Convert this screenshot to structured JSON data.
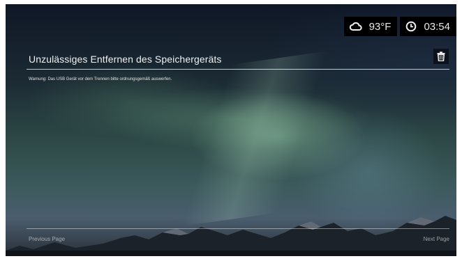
{
  "status": {
    "weather_icon": "cloud-icon",
    "temperature": "93°F",
    "clock_icon": "clock-icon",
    "time": "03:54"
  },
  "notification": {
    "title": "Unzulässiges Entfernen des Speichergeräts",
    "message": "Warnung: Das USB Gerät vor dem Trennen bitte ordnungsgemäß auswerfen.",
    "delete_icon": "trash-icon"
  },
  "pagination": {
    "previous_label": "Previous Page",
    "next_label": "Next Page"
  },
  "colors": {
    "overlay_pill": "#000000",
    "text": "#f0f0f0"
  }
}
